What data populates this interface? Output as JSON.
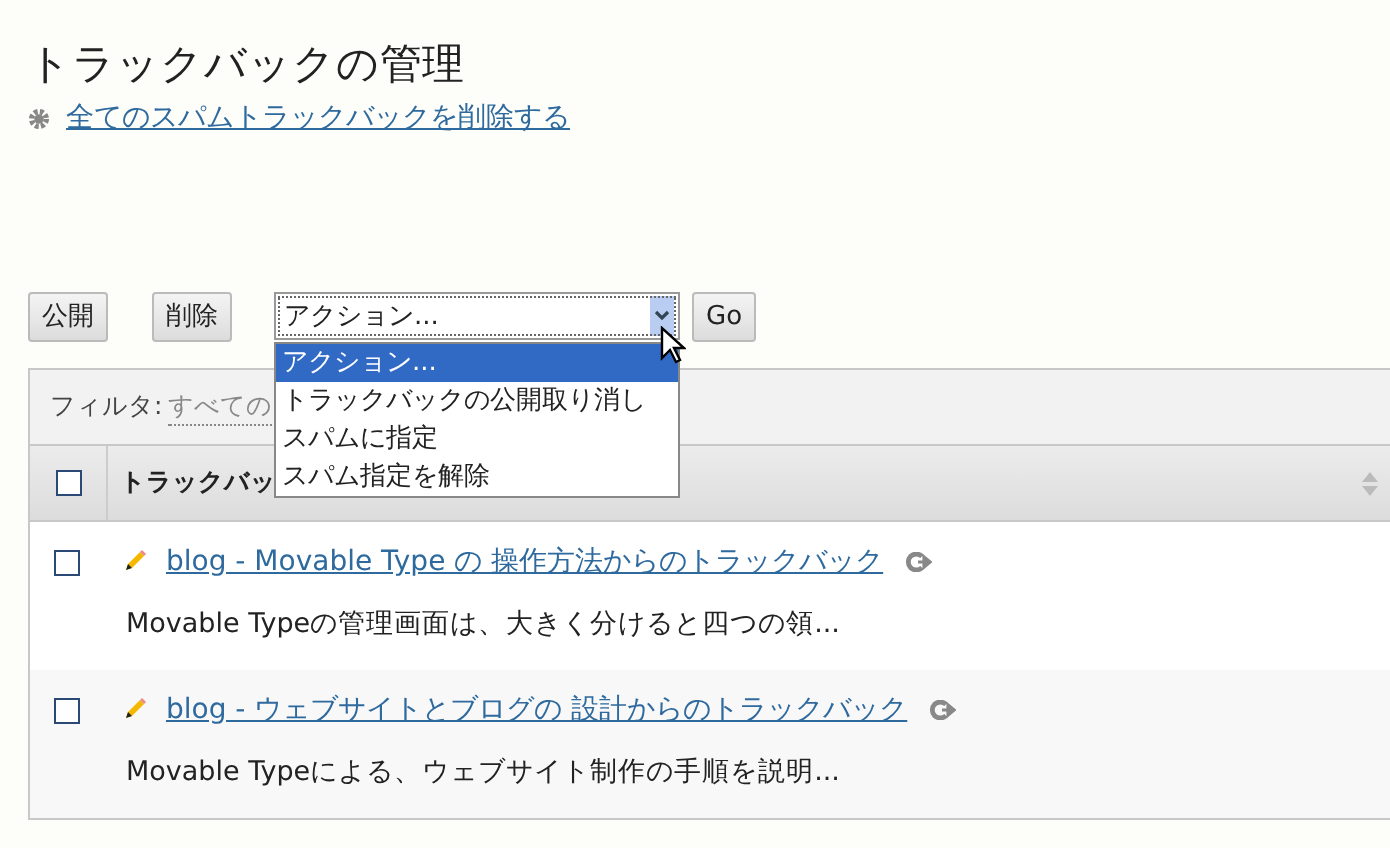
{
  "title": "トラックバックの管理",
  "delete_spam_link": "全てのスパムトラックバックを削除する",
  "buttons": [
    {
      "label": "公開"
    },
    {
      "label": "削除"
    }
  ],
  "action_select": {
    "value": "アクション...",
    "expanded": true,
    "options": [
      {
        "label": "アクション...",
        "selected": true
      },
      {
        "label": "トラックバックの公開取り消し",
        "selected": false
      },
      {
        "label": "スパムに指定",
        "selected": false
      },
      {
        "label": "スパム指定を解除",
        "selected": false
      }
    ]
  },
  "go_button": "Go",
  "filter": {
    "label": "フィルタ:",
    "value": "すべての"
  },
  "table": {
    "header_checked": false,
    "column": "トラックバッ",
    "rows": [
      {
        "checked": false,
        "title": "blog - Movable Type の 操作方法からのトラックバック",
        "excerpt": "Movable Typeの管理画面は、大きく分けると四つの領..."
      },
      {
        "checked": false,
        "title": "blog - ウェブサイトとブログの 設計からのトラックバック",
        "excerpt": "Movable Typeによる、ウェブサイト制作の手順を説明..."
      }
    ]
  }
}
